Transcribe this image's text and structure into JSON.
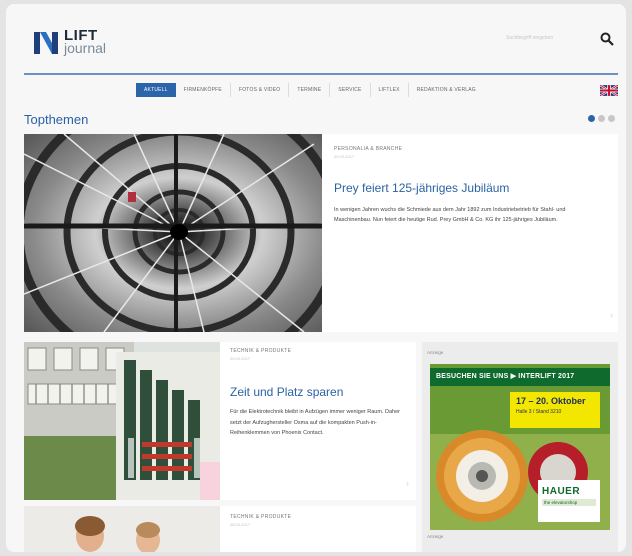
{
  "header": {
    "logo_line1": "LIFT",
    "logo_line2": "journal",
    "search_placeholder": "Suchbegriff eingeben",
    "search_icon": "search-icon",
    "language_icon": "uk-flag-icon"
  },
  "nav": {
    "items": [
      {
        "label": "AKTUELL",
        "active": true
      },
      {
        "label": "FIRMENKÖPFE",
        "active": false
      },
      {
        "label": "FOTOS & VIDEO",
        "active": false
      },
      {
        "label": "TERMINE",
        "active": false
      },
      {
        "label": "SERVICE",
        "active": false
      },
      {
        "label": "LIFTLEX",
        "active": false
      },
      {
        "label": "REDAKTION & VERLAG",
        "active": false
      }
    ]
  },
  "topthemen": {
    "title": "Topthemen",
    "slide_indicators": 3,
    "active_slide": 1
  },
  "articles": [
    {
      "kicker": "PERSONALIA & BRANCHE",
      "date": "09.03.2017",
      "title": "Prey feiert 125-jähriges Jubiläum",
      "text": "In wenigen Jahren wuchs die Schmiede aus dem Jahr 1892 zum Industriebetrieb für Stahl- und Maschinenbau. Nun feiert die heutige Rud. Prey GmbH & Co. KG ihr 125-jähriges Jubiläum."
    },
    {
      "kicker": "TECHNIK & PRODUKTE",
      "date": "09.03.2017",
      "title": "Zeit und Platz sparen",
      "text": "Für die Elektrotechnik bleibt in Aufzügen immer weniger Raum. Daher setzt der Aufzughersteller Osma auf die kompakten Push-in-Reihenklemmen von Phoenix Contact."
    },
    {
      "kicker": "TECHNIK & PRODUKTE",
      "date": "08.03.2017"
    }
  ],
  "ad": {
    "label_top": "Anzeige",
    "label_bottom": "Anzeige",
    "headline": "BESUCHEN SIE UNS ▶ INTERLIFT 2017",
    "dates": "17 – 20. Oktober",
    "hall": "Halle 3 / Stand 3210",
    "brand": "HAUER",
    "brand_tagline": "the elevatorshop"
  },
  "colors": {
    "accent": "#2b62a6",
    "nav_active": "#2c64aa",
    "rule": "#6d8fc2",
    "ad_green": "#0f6a2e",
    "ad_yellow": "#f3e600"
  }
}
